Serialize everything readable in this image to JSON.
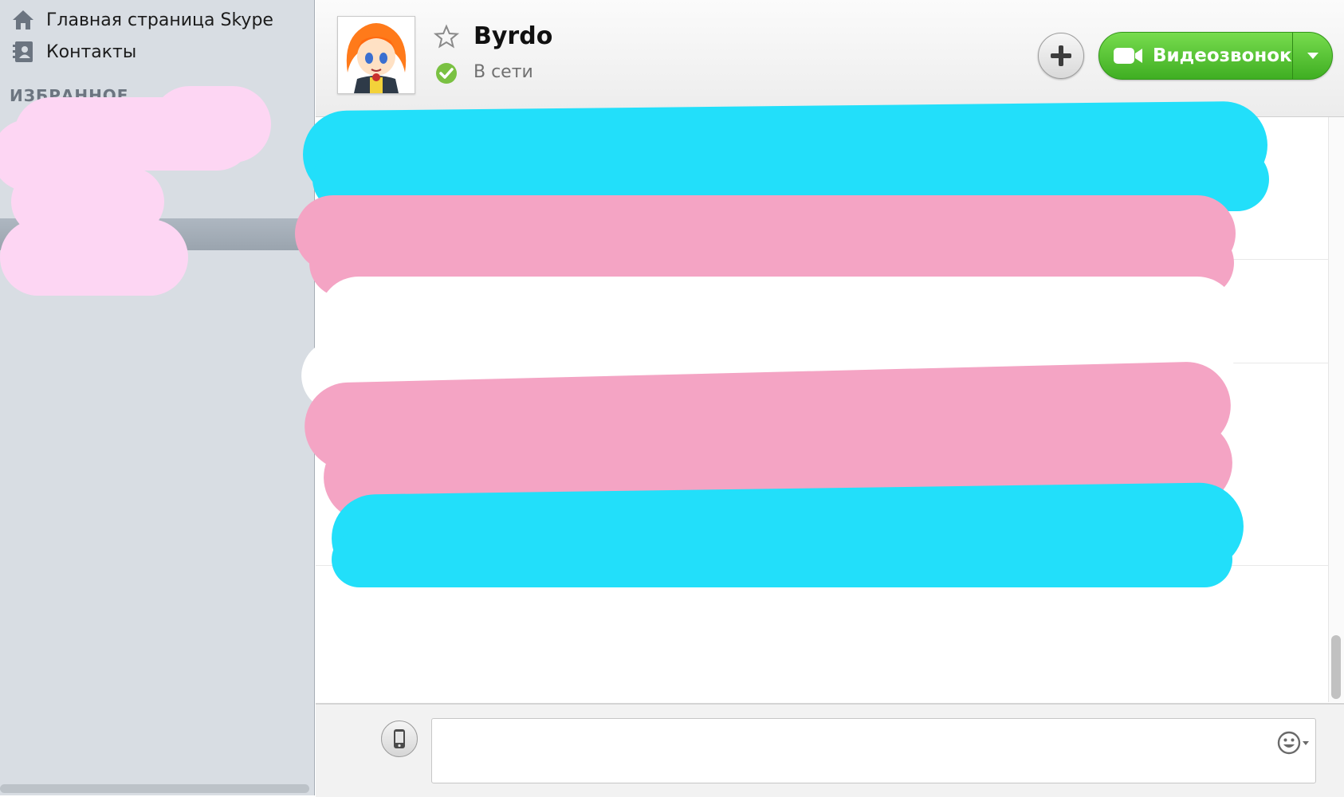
{
  "sidebar": {
    "home_label": "Главная страница Skype",
    "contacts_label": "Контакты",
    "favorites_heading": "ИЗБРАННОЕ",
    "home_icon": "home-icon",
    "contacts_icon": "contacts-book-icon"
  },
  "header": {
    "contact_name": "Byrdo",
    "status_text": "В сети",
    "status_color": "#7ac142",
    "video_call_label": "Видеозвонок",
    "video_call_color": "#4fc02f"
  },
  "composer": {
    "message_value": "",
    "sms_icon": "mobile-phone-icon",
    "emoji_icon": "smiley-icon"
  },
  "redaction_colors": {
    "sidebar_blob": "#fdd6f3",
    "blue": "#22dffa",
    "pink": "#f4a4c4",
    "white": "#ffffff"
  }
}
